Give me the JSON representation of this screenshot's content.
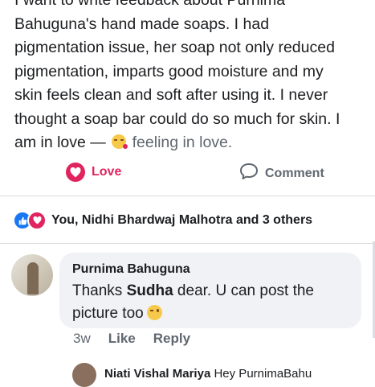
{
  "post": {
    "text_lines": [
      "I want to write feedback about Purnima",
      "Bahuguna's hand made soaps. I had",
      "pigmentation issue, her soap not only reduced",
      "pigmentation, imparts good moisture and my",
      "skin feels clean and soft after using it. I never",
      "thought a soap bar could do so much for skin. I"
    ],
    "last_line_prefix": "am in love —",
    "feeling_text": "feeling in love.",
    "feeling_icon": "in-love-emoji-icon"
  },
  "actions": {
    "love_label": "Love",
    "love_icon": "heart-icon",
    "comment_label": "Comment",
    "comment_icon": "comment-bubble-icon",
    "love_color": "#e0245e"
  },
  "reactions": {
    "summary": "You, Nidhi Bhardwaj Malhotra and 3 others",
    "icons": [
      "like-icon",
      "love-icon"
    ]
  },
  "comment": {
    "author": "Purnima Bahuguna",
    "text_before": "Thanks ",
    "mention": "Sudha",
    "text_after": " dear. U can post the picture too",
    "emoji_icon": "wink-emoji-icon",
    "time": "3w",
    "like_label": "Like",
    "reply_label": "Reply"
  },
  "next_reply": {
    "author": "Niati Vishal Mariya",
    "text": "Hey PurnimaBahu"
  },
  "colors": {
    "text": "#1c1e21",
    "secondary": "#606770",
    "bubble": "#f0f2f5",
    "like_blue": "#1877f2"
  }
}
